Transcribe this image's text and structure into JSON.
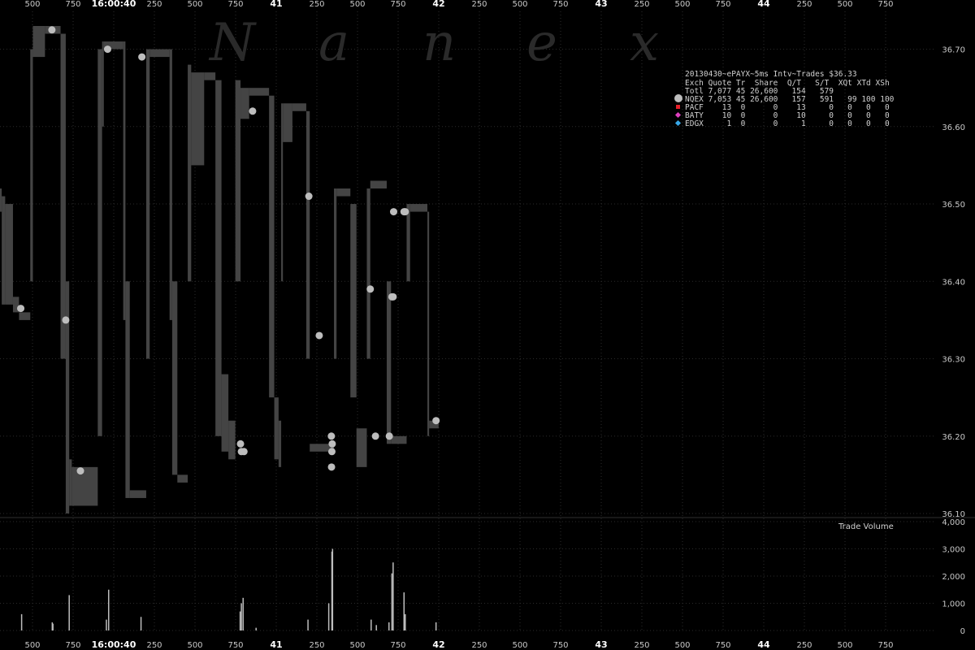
{
  "title": "20130430~ePAYX~5ms Intv~Trades $36.33",
  "watermark": [
    "N",
    "a",
    "n",
    "e",
    "x"
  ],
  "colors": {
    "background": "#000000",
    "band": "#444444",
    "trade": "#bdbdbd",
    "grid": "#2b2b2b",
    "PACF": "#e8202a",
    "BATY": "#e040c0",
    "EDGX": "#38a8e8"
  },
  "info_table": {
    "header": "Exch Quote Tr  Share  Q/T   S/T  XQt XTd XSh",
    "rows": [
      {
        "exch": "Totl",
        "marker": "none",
        "text": "Totl 7,077 45 26,600   154   579"
      },
      {
        "exch": "NQEX",
        "marker": "circle-icon",
        "text": "NQEX 7,053 45 26,600   157   591   99 100 100"
      },
      {
        "exch": "PACF",
        "marker": "square-icon",
        "text": "PACF    13  0      0    13     0   0   0   0"
      },
      {
        "exch": "BATY",
        "marker": "diamond-icon",
        "text": "BATY    10  0      0    10     0   0   0   0"
      },
      {
        "exch": "EDGX",
        "marker": "diamond-icon",
        "text": "EDGX     1  0      0     1     0   0   0   0"
      }
    ]
  },
  "chart_data": [
    {
      "type": "area",
      "name": "price",
      "grid": true,
      "x_ticks": [
        {
          "label": "500",
          "major": false
        },
        {
          "label": "750",
          "major": false
        },
        {
          "label": "16:00:40",
          "major": true
        },
        {
          "label": "250",
          "major": false
        },
        {
          "label": "500",
          "major": false
        },
        {
          "label": "750",
          "major": false
        },
        {
          "label": "41",
          "major": true
        },
        {
          "label": "250",
          "major": false
        },
        {
          "label": "500",
          "major": false
        },
        {
          "label": "750",
          "major": false
        },
        {
          "label": "42",
          "major": true
        },
        {
          "label": "250",
          "major": false
        },
        {
          "label": "500",
          "major": false
        },
        {
          "label": "750",
          "major": false
        },
        {
          "label": "43",
          "major": true
        },
        {
          "label": "250",
          "major": false
        },
        {
          "label": "500",
          "major": false
        },
        {
          "label": "750",
          "major": false
        },
        {
          "label": "44",
          "major": true
        },
        {
          "label": "250",
          "major": false
        },
        {
          "label": "500",
          "major": false
        },
        {
          "label": "750",
          "major": false
        }
      ],
      "x_range_ms": [
        39500,
        44800
      ],
      "y_ticks": [
        "36.10",
        "36.20",
        "36.30",
        "36.40",
        "36.50",
        "36.60",
        "36.70"
      ],
      "ylim": [
        36.1,
        36.73
      ],
      "quote_band": [
        {
          "x0": 39400,
          "x1": 39410,
          "bid": 36.49,
          "ask": 36.52
        },
        {
          "x0": 39410,
          "x1": 39430,
          "bid": 36.37,
          "ask": 36.51
        },
        {
          "x0": 39430,
          "x1": 39475,
          "bid": 36.37,
          "ask": 36.5
        },
        {
          "x0": 39475,
          "x1": 39510,
          "bid": 36.36,
          "ask": 36.38
        },
        {
          "x0": 39510,
          "x1": 39575,
          "bid": 36.35,
          "ask": 36.36
        },
        {
          "x0": 39575,
          "x1": 39590,
          "bid": 36.4,
          "ask": 36.7
        },
        {
          "x0": 39590,
          "x1": 39660,
          "bid": 36.69,
          "ask": 36.73
        },
        {
          "x0": 39660,
          "x1": 39750,
          "bid": 36.72,
          "ask": 36.73
        },
        {
          "x0": 39750,
          "x1": 39780,
          "bid": 36.3,
          "ask": 36.72
        },
        {
          "x0": 39780,
          "x1": 39800,
          "bid": 36.1,
          "ask": 36.4
        },
        {
          "x0": 39800,
          "x1": 39815,
          "bid": 36.11,
          "ask": 36.17
        },
        {
          "x0": 39815,
          "x1": 39965,
          "bid": 36.11,
          "ask": 36.16
        },
        {
          "x0": 39965,
          "x1": 39990,
          "bid": 36.2,
          "ask": 36.7
        },
        {
          "x0": 39990,
          "x1": 40000,
          "bid": 36.6,
          "ask": 36.71
        },
        {
          "x0": 40000,
          "x1": 40112,
          "bid": 36.7,
          "ask": 36.71
        },
        {
          "x0": 40112,
          "x1": 40125,
          "bid": 36.35,
          "ask": 36.71
        },
        {
          "x0": 40125,
          "x1": 40150,
          "bid": 36.12,
          "ask": 36.4
        },
        {
          "x0": 40150,
          "x1": 40245,
          "bid": 36.12,
          "ask": 36.13
        },
        {
          "x0": 40245,
          "x1": 40265,
          "bid": 36.3,
          "ask": 36.7
        },
        {
          "x0": 40265,
          "x1": 40380,
          "bid": 36.69,
          "ask": 36.7
        },
        {
          "x0": 40380,
          "x1": 40395,
          "bid": 36.35,
          "ask": 36.7
        },
        {
          "x0": 40395,
          "x1": 40425,
          "bid": 36.15,
          "ask": 36.4
        },
        {
          "x0": 40425,
          "x1": 40485,
          "bid": 36.14,
          "ask": 36.15
        },
        {
          "x0": 40485,
          "x1": 40505,
          "bid": 36.4,
          "ask": 36.68
        },
        {
          "x0": 40505,
          "x1": 40580,
          "bid": 36.55,
          "ask": 36.67
        },
        {
          "x0": 40580,
          "x1": 40645,
          "bid": 36.66,
          "ask": 36.67
        },
        {
          "x0": 40645,
          "x1": 40680,
          "bid": 36.2,
          "ask": 36.66
        },
        {
          "x0": 40680,
          "x1": 40720,
          "bid": 36.18,
          "ask": 36.28
        },
        {
          "x0": 40720,
          "x1": 40760,
          "bid": 36.17,
          "ask": 36.22
        },
        {
          "x0": 40760,
          "x1": 40790,
          "bid": 36.4,
          "ask": 36.66
        },
        {
          "x0": 40790,
          "x1": 40840,
          "bid": 36.61,
          "ask": 36.65
        },
        {
          "x0": 40840,
          "x1": 40955,
          "bid": 36.64,
          "ask": 36.65
        },
        {
          "x0": 40955,
          "x1": 40985,
          "bid": 36.25,
          "ask": 36.64
        },
        {
          "x0": 40985,
          "x1": 41010,
          "bid": 36.17,
          "ask": 36.25
        },
        {
          "x0": 41010,
          "x1": 41025,
          "bid": 36.16,
          "ask": 36.22
        },
        {
          "x0": 41025,
          "x1": 41035,
          "bid": 36.4,
          "ask": 36.63
        },
        {
          "x0": 41035,
          "x1": 41090,
          "bid": 36.58,
          "ask": 36.63
        },
        {
          "x0": 41090,
          "x1": 41170,
          "bid": 36.62,
          "ask": 36.63
        },
        {
          "x0": 41170,
          "x1": 41190,
          "bid": 36.3,
          "ask": 36.62
        },
        {
          "x0": 41190,
          "x1": 41330,
          "bid": 36.18,
          "ask": 36.19
        },
        {
          "x0": 41330,
          "x1": 41345,
          "bid": 36.3,
          "ask": 36.52
        },
        {
          "x0": 41345,
          "x1": 41425,
          "bid": 36.51,
          "ask": 36.52
        },
        {
          "x0": 41425,
          "x1": 41460,
          "bid": 36.25,
          "ask": 36.5
        },
        {
          "x0": 41460,
          "x1": 41520,
          "bid": 36.16,
          "ask": 36.21
        },
        {
          "x0": 41520,
          "x1": 41540,
          "bid": 36.3,
          "ask": 36.52
        },
        {
          "x0": 41540,
          "x1": 41635,
          "bid": 36.52,
          "ask": 36.53
        },
        {
          "x0": 41635,
          "x1": 41660,
          "bid": 36.19,
          "ask": 36.4
        },
        {
          "x0": 41660,
          "x1": 41750,
          "bid": 36.19,
          "ask": 36.2
        },
        {
          "x0": 41750,
          "x1": 41770,
          "bid": 36.4,
          "ask": 36.5
        },
        {
          "x0": 41770,
          "x1": 41870,
          "bid": 36.49,
          "ask": 36.5
        },
        {
          "x0": 41870,
          "x1": 41880,
          "bid": 36.2,
          "ask": 36.49
        },
        {
          "x0": 41880,
          "x1": 41935,
          "bid": 36.21,
          "ask": 36.22
        }
      ],
      "trades": [
        {
          "x": 39520,
          "price": 36.365
        },
        {
          "x": 39700,
          "price": 36.725
        },
        {
          "x": 39780,
          "price": 36.35
        },
        {
          "x": 39865,
          "price": 36.155
        },
        {
          "x": 40022,
          "price": 36.7
        },
        {
          "x": 40220,
          "price": 36.69
        },
        {
          "x": 40790,
          "price": 36.19
        },
        {
          "x": 40795,
          "price": 36.18
        },
        {
          "x": 40810,
          "price": 36.18
        },
        {
          "x": 40860,
          "price": 36.62
        },
        {
          "x": 41185,
          "price": 36.51
        },
        {
          "x": 41245,
          "price": 36.33
        },
        {
          "x": 41315,
          "price": 36.2
        },
        {
          "x": 41320,
          "price": 36.19
        },
        {
          "x": 41318,
          "price": 36.18
        },
        {
          "x": 41316,
          "price": 36.16
        },
        {
          "x": 41540,
          "price": 36.39
        },
        {
          "x": 41570,
          "price": 36.2
        },
        {
          "x": 41650,
          "price": 36.2
        },
        {
          "x": 41665,
          "price": 36.38
        },
        {
          "x": 41672,
          "price": 36.38
        },
        {
          "x": 41675,
          "price": 36.49
        },
        {
          "x": 41735,
          "price": 36.49
        },
        {
          "x": 41742,
          "price": 36.49
        },
        {
          "x": 41920,
          "price": 36.22
        }
      ]
    },
    {
      "type": "bar",
      "name": "volume",
      "title": "Trade Volume",
      "y_ticks": [
        "0",
        "1,000",
        "2,000",
        "3,000",
        "4,000"
      ],
      "ylim": [
        0,
        4000
      ],
      "bars": [
        {
          "x": 39525,
          "value": 600
        },
        {
          "x": 39702,
          "value": 300
        },
        {
          "x": 39706,
          "value": 250
        },
        {
          "x": 39800,
          "value": 1300
        },
        {
          "x": 40015,
          "value": 400
        },
        {
          "x": 40028,
          "value": 1500
        },
        {
          "x": 40215,
          "value": 500
        },
        {
          "x": 40788,
          "value": 700
        },
        {
          "x": 40795,
          "value": 1000
        },
        {
          "x": 40805,
          "value": 1200
        },
        {
          "x": 40880,
          "value": 100
        },
        {
          "x": 41180,
          "value": 400
        },
        {
          "x": 41300,
          "value": 1000
        },
        {
          "x": 41318,
          "value": 2900
        },
        {
          "x": 41322,
          "value": 3000
        },
        {
          "x": 41545,
          "value": 400
        },
        {
          "x": 41575,
          "value": 200
        },
        {
          "x": 41648,
          "value": 300
        },
        {
          "x": 41665,
          "value": 2100
        },
        {
          "x": 41672,
          "value": 2500
        },
        {
          "x": 41735,
          "value": 1400
        },
        {
          "x": 41742,
          "value": 600
        },
        {
          "x": 41920,
          "value": 300
        }
      ]
    }
  ]
}
